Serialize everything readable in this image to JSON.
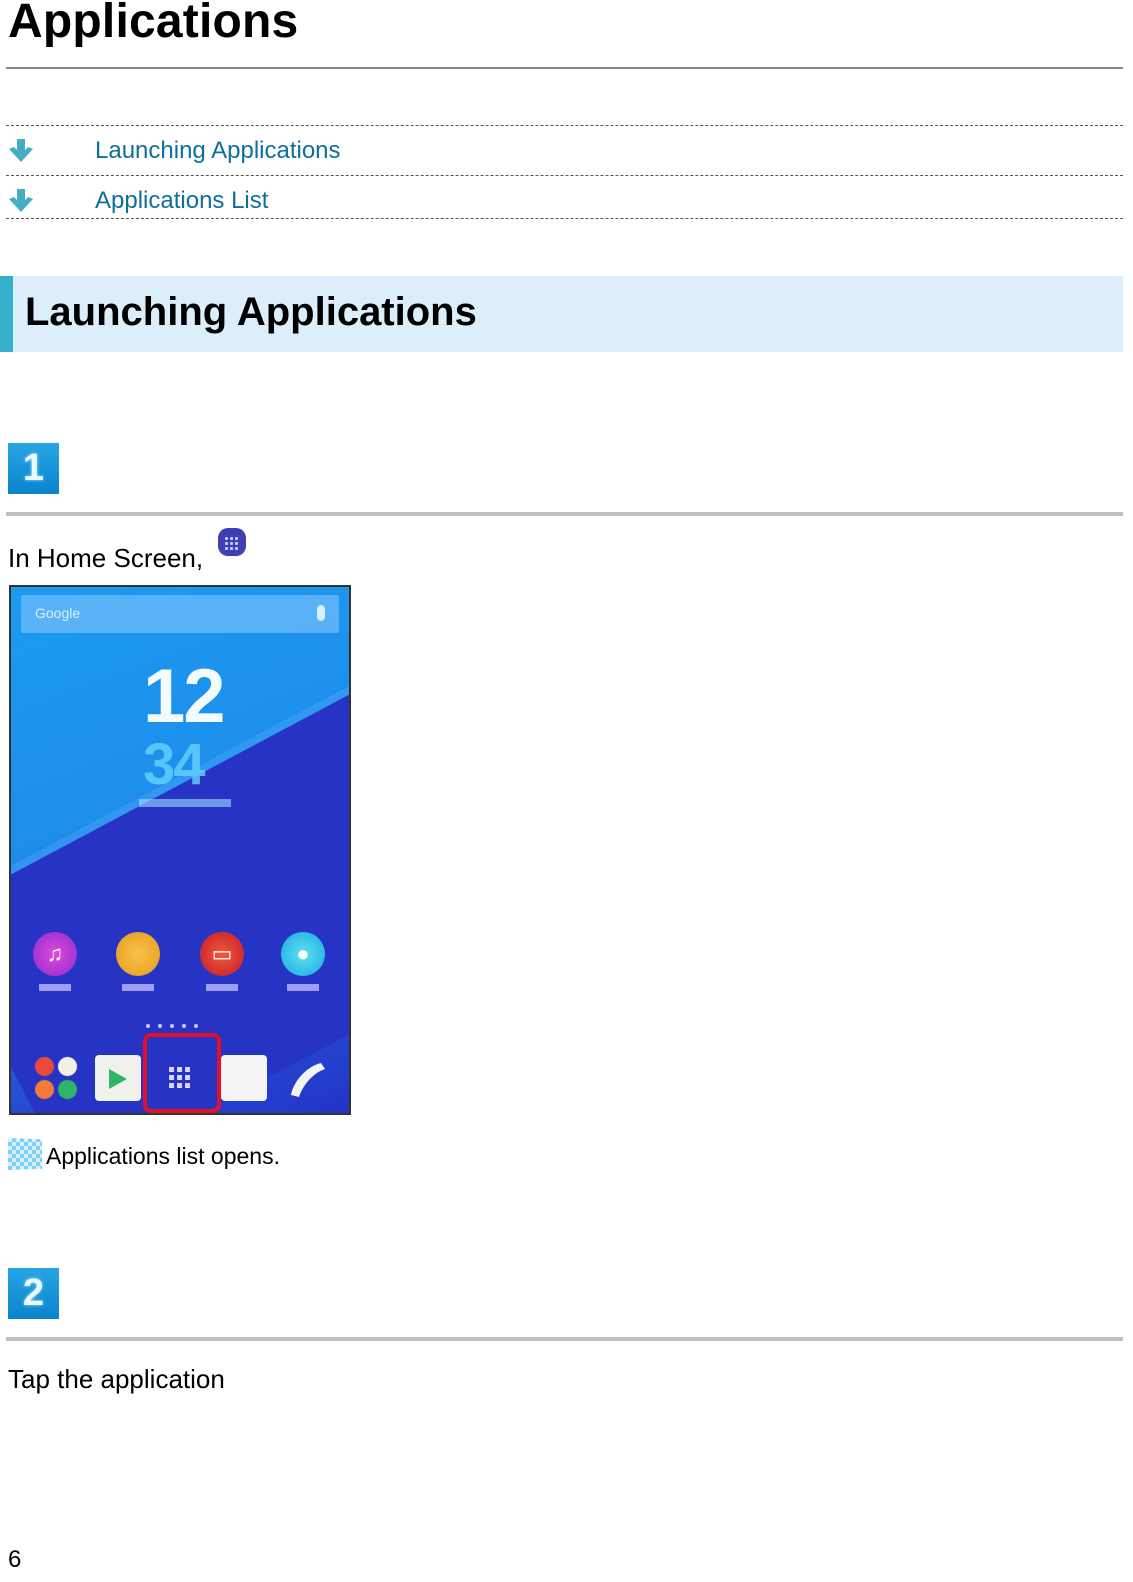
{
  "page": {
    "title": "Applications",
    "page_number": "6"
  },
  "toc": {
    "items": [
      {
        "label": "Launching Applications",
        "icon": "arrow-down-icon"
      },
      {
        "label": "Applications List",
        "icon": "arrow-down-icon"
      }
    ],
    "arrow_color": "#45aec4",
    "link_color": "#0d6f9c"
  },
  "section": {
    "heading": "Launching Applications",
    "accent_color": "#35b0c8",
    "background_color": "#dbeefa"
  },
  "steps": [
    {
      "number": "1",
      "text": "In Home Screen,",
      "inline_icon": "apps-grid-icon",
      "screenshot": {
        "clock_hour": "12",
        "clock_minute": "34",
        "search_label": "Google",
        "apps": [
          "music-icon",
          "album-icon",
          "video-icon",
          "contacts-icon"
        ],
        "dock": [
          "google-folder-icon",
          "play-store-icon",
          "apps-grid-icon",
          "email-icon",
          "phone-icon"
        ],
        "highlighted": "apps-grid-icon",
        "highlight_color": "#e0102a"
      },
      "result": "Applications list opens.",
      "result_icon": "checkered-flag-icon"
    },
    {
      "number": "2",
      "text": "Tap the application"
    }
  ]
}
